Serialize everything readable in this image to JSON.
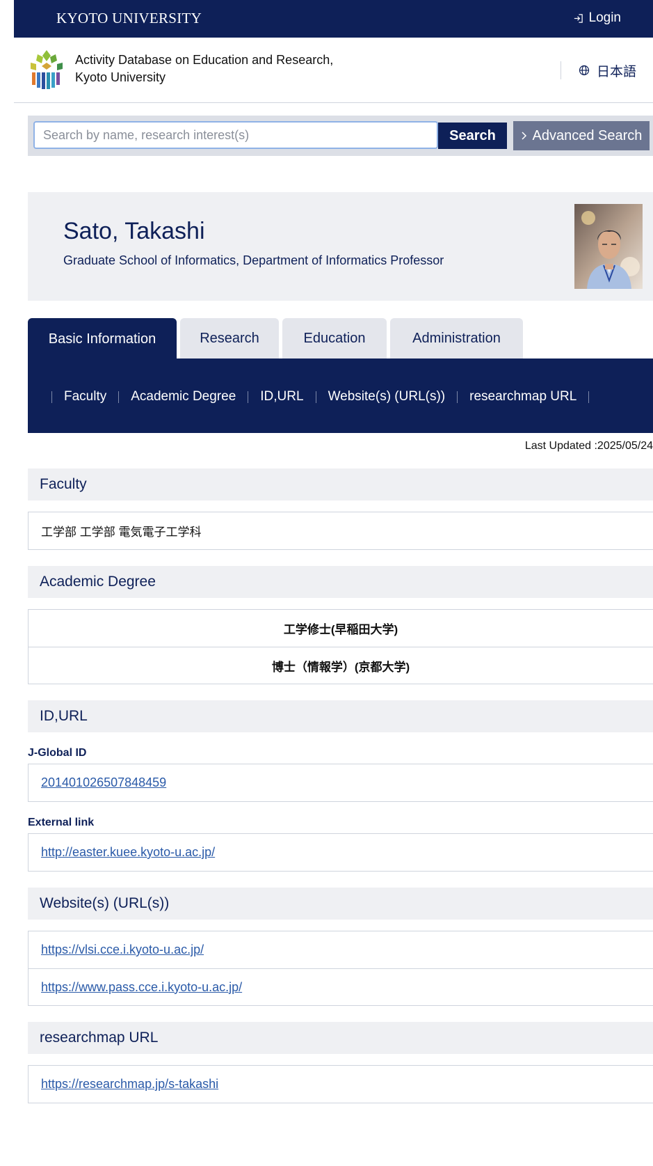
{
  "topbar": {
    "university": "KYOTO UNIVERSITY",
    "login_label": "Login"
  },
  "header": {
    "site_title_line1": "Activity Database on Education and Research,",
    "site_title_line2": "Kyoto University",
    "language_label": "日本語"
  },
  "search": {
    "placeholder": "Search by name, research interest(s)",
    "value": "",
    "search_label": "Search",
    "advanced_label": "Advanced Search"
  },
  "profile": {
    "name": "Sato, Takashi",
    "affiliation": "Graduate School of Informatics, Department of Informatics Professor"
  },
  "tabs": [
    {
      "label": "Basic Information",
      "active": true
    },
    {
      "label": "Research",
      "active": false
    },
    {
      "label": "Education",
      "active": false
    },
    {
      "label": "Administration",
      "active": false
    }
  ],
  "subnav": [
    "Faculty",
    "Academic Degree",
    "ID,URL",
    "Website(s) (URL(s))",
    "researchmap URL"
  ],
  "last_updated": "Last Updated :2025/05/24",
  "faculty": {
    "heading": "Faculty",
    "value": "工学部 工学部 電気電子工学科"
  },
  "academic_degree": {
    "heading": "Academic Degree",
    "items": [
      "工学修士(早稲田大学)",
      "博士（情報学）(京都大学)"
    ]
  },
  "id_url": {
    "heading": "ID,URL",
    "jglobal_label": "J-Global ID",
    "jglobal_value": "201401026507848459",
    "external_label": "External link",
    "external_value": "http://easter.kuee.kyoto-u.ac.jp/"
  },
  "websites": {
    "heading": "Website(s) (URL(s))",
    "items": [
      "https://vlsi.cce.i.kyoto-u.ac.jp/",
      "https://www.pass.cce.i.kyoto-u.ac.jp/"
    ]
  },
  "researchmap": {
    "heading": "researchmap URL",
    "value": "https://researchmap.jp/s-takashi"
  },
  "colors": {
    "navy": "#0e2058",
    "panel": "#eff0f3",
    "link": "#2a5aa8",
    "advanced_button": "#6b7591"
  },
  "icons": [
    "login-icon",
    "globe-icon",
    "chevron-right-icon",
    "university-logo"
  ]
}
